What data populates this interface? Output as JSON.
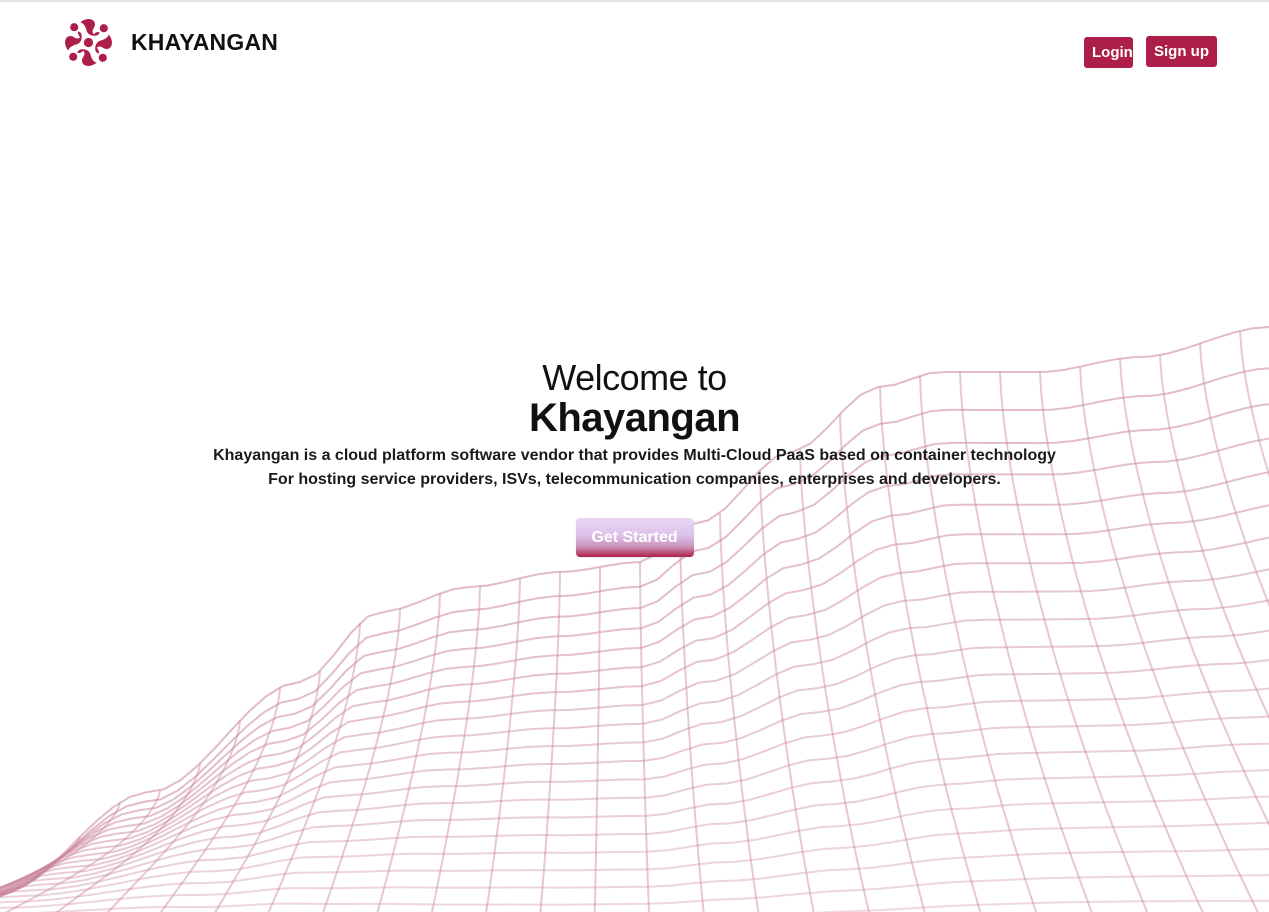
{
  "brand": {
    "name": "KHAYANGAN",
    "logo_icon": "knot-logo-icon",
    "color": "#ad1f48"
  },
  "nav": {
    "login_label": "Login",
    "signup_label": "Sign up"
  },
  "hero": {
    "welcome": "Welcome to",
    "title": "Khayangan",
    "description_line1": "Khayangan is a cloud platform software vendor that provides Multi-Cloud PaaS based on container technology",
    "description_line2": "For hosting service providers, ISVs, telecommunication companies, enterprises and developers.",
    "cta_label": "Get Started"
  },
  "theme": {
    "accent": "#ad1f48",
    "mesh_color": "#c9849a"
  }
}
